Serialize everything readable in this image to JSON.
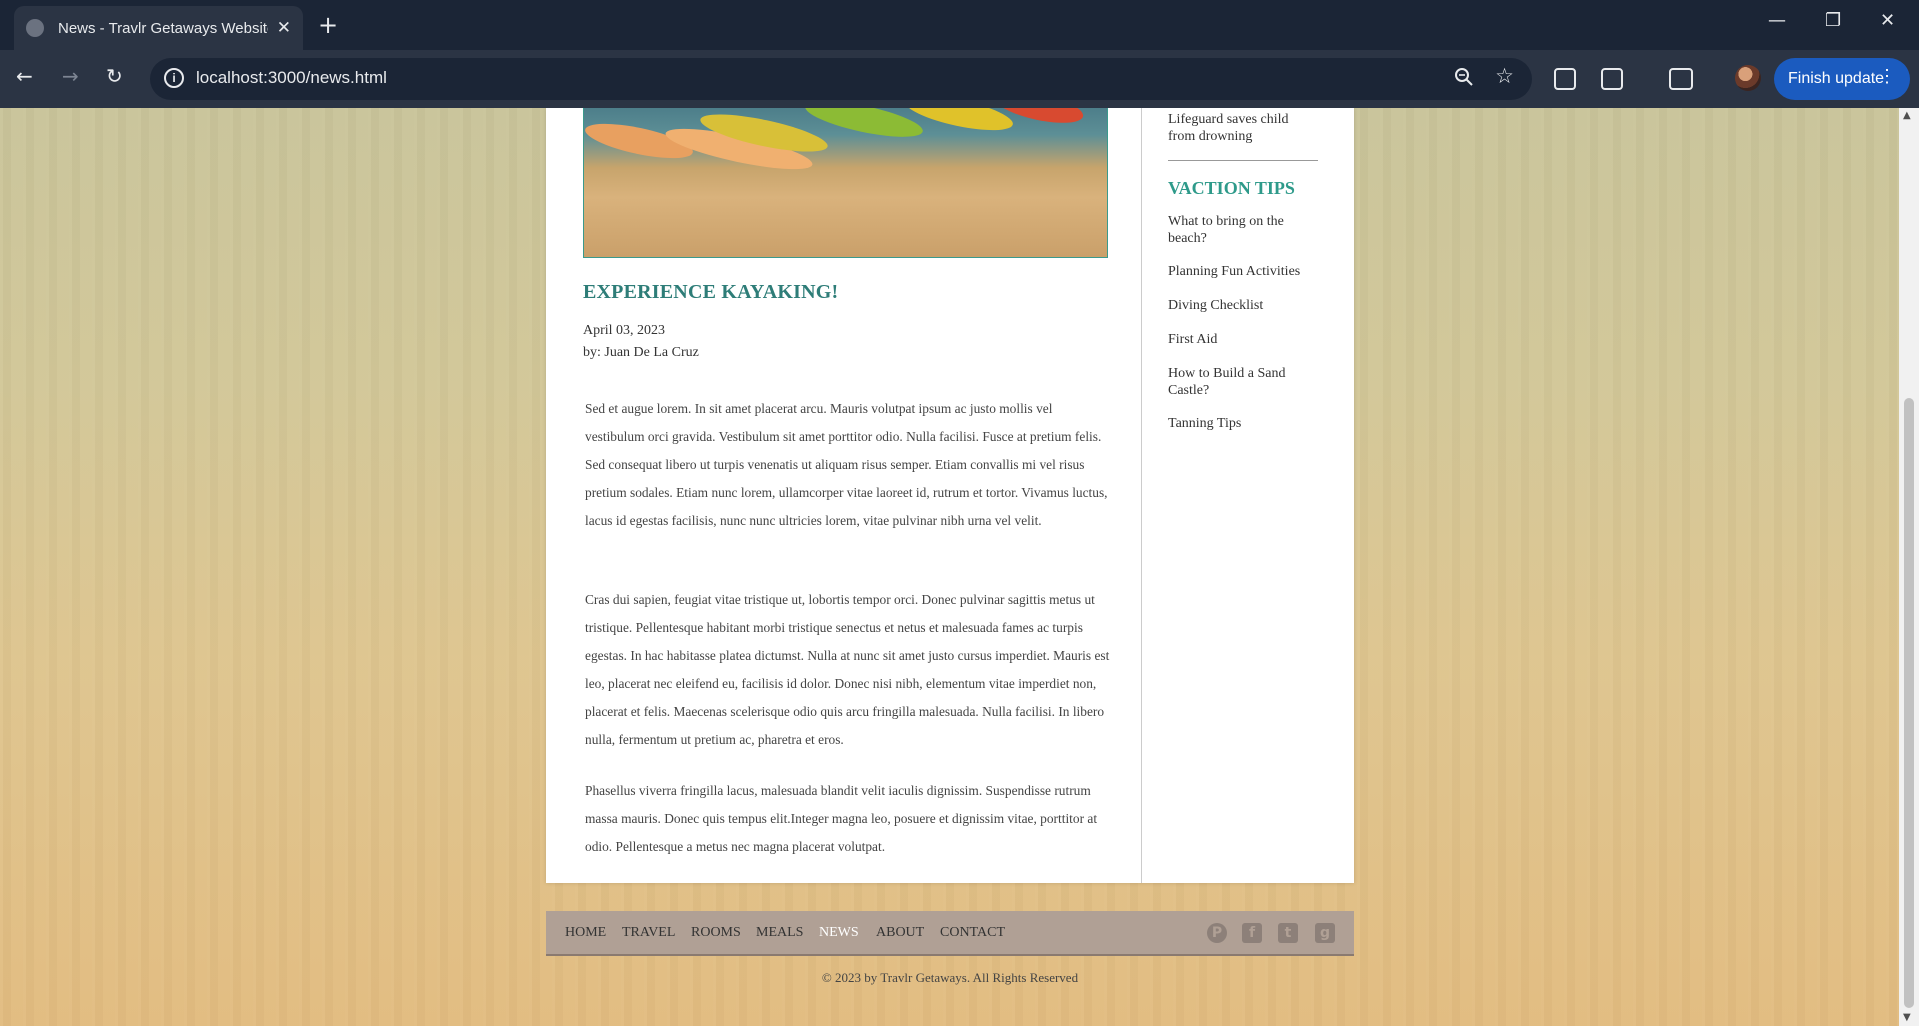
{
  "browser": {
    "tab_title": "News - Travlr Getaways Website",
    "url": "localhost:3000/news.html",
    "finish_update": "Finish update"
  },
  "post": {
    "title": "EXPERIENCE KAYAKING!",
    "date": "April 03, 2023",
    "author": "by: Juan De La Cruz",
    "paragraphs": [
      "Sed et augue lorem. In sit amet placerat arcu. Mauris volutpat ipsum ac justo mollis vel vestibulum orci gravida. Vestibulum sit amet porttitor odio. Nulla facilisi. Fusce at pretium felis. Sed consequat libero ut turpis venenatis ut aliquam risus semper. Etiam convallis mi vel risus pretium sodales. Etiam nunc lorem, ullamcorper vitae laoreet id, rutrum et tortor. Vivamus luctus, lacus id egestas facilisis, nunc nunc ultricies lorem, vitae pulvinar nibh urna vel velit.",
      "Cras dui sapien, feugiat vitae tristique ut, lobortis tempor orci. Donec pulvinar sagittis metus ut tristique. Pellentesque habitant morbi tristique senectus et netus et malesuada fames ac turpis egestas. In hac habitasse platea dictumst. Nulla at nunc sit amet justo cursus imperdiet. Mauris est leo, placerat nec eleifend eu, facilisis id dolor. Donec nisi nibh, elementum vitae imperdiet non, placerat et felis. Maecenas scelerisque odio quis arcu fringilla malesuada. Nulla facilisi. In libero nulla, fermentum ut pretium ac, pharetra et eros.",
      "Phasellus viverra fringilla lacus, malesuada blandit velit iaculis dignissim. Suspendisse rutrum massa mauris. Donec quis tempus elit.Integer magna leo, posuere et dignissim vitae, porttitor at odio. Pellentesque a metus nec magna placerat volutpat."
    ]
  },
  "sidebar": {
    "news_items": [
      "Lifeguard saves child from drowning"
    ],
    "tips_heading": "VACTION TIPS",
    "tips": [
      "What to bring on the beach?",
      "Planning Fun Activities",
      "Diving Checklist",
      "First Aid",
      "How to Build a Sand Castle?",
      "Tanning Tips"
    ]
  },
  "footer": {
    "nav": [
      "HOME",
      "TRAVEL",
      "ROOMS",
      "MEALS",
      "NEWS",
      "ABOUT",
      "CONTACT"
    ],
    "active": "NEWS",
    "social_icons": [
      "pinterest-icon",
      "facebook-icon",
      "twitter-icon",
      "google-plus-icon"
    ],
    "copyright": "© 2023 by Travlr Getaways. All Rights Reserved"
  },
  "colors": {
    "accent_teal": "#2e7d78",
    "footer_bg": "#b0a095",
    "chrome_bg": "#1b2536",
    "update_button": "#1b5bbf"
  }
}
